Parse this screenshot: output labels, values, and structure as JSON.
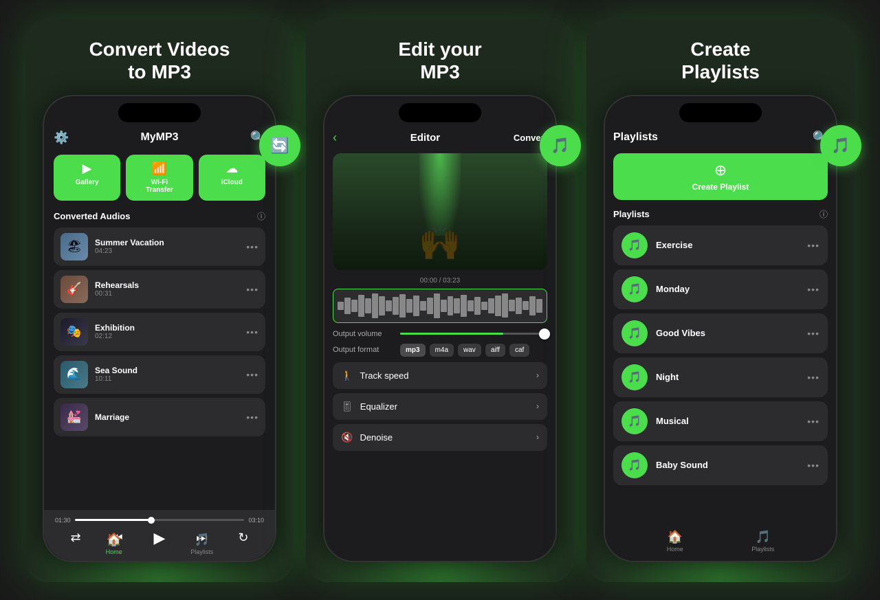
{
  "panels": [
    {
      "title": "Convert Videos\nto MP3",
      "floatingIcon": "🔄",
      "phone": {
        "header": {
          "appName": "MyMP3",
          "settingsIcon": "⚙️",
          "searchIcon": "🔍"
        },
        "sourceBtns": [
          {
            "label": "Gallery",
            "icon": "▶"
          },
          {
            "label": "Wi-Fi\nTransfer",
            "icon": "📶"
          },
          {
            "label": "iCloud",
            "icon": "☁"
          }
        ],
        "sectionTitle": "Converted Audios",
        "tracks": [
          {
            "name": "Summer Vacation",
            "time": "04:23",
            "thumbClass": "thumb-summer",
            "emoji": "🏖"
          },
          {
            "name": "Rehearsals",
            "time": "00:31",
            "thumbClass": "thumb-rehearsal",
            "emoji": "🎸"
          },
          {
            "name": "Exhibition",
            "time": "02:12",
            "thumbClass": "thumb-exhibition",
            "emoji": "🎭"
          },
          {
            "name": "Sea Sound",
            "time": "10:11",
            "thumbClass": "thumb-sea",
            "emoji": "🌊"
          },
          {
            "name": "Marriage",
            "time": "",
            "thumbClass": "thumb-marriage",
            "emoji": "💒"
          }
        ],
        "player": {
          "timeStart": "01:30",
          "timeEnd": "03:10"
        },
        "nav": [
          {
            "label": "Home",
            "icon": "🏠",
            "active": true
          },
          {
            "label": "Playlists",
            "icon": "🎵",
            "active": false
          }
        ]
      }
    },
    {
      "title": "Edit your\nMP3",
      "floatingIcon": "🎵",
      "phone": {
        "header": {
          "backLabel": "‹",
          "title": "Editor",
          "convertLabel": "Convert"
        },
        "timeDisplay": "00:00 / 03:23",
        "outputVolume": "Output volume",
        "outputFormat": "Output format",
        "formats": [
          "mp3",
          "m4a",
          "wav",
          "aiff",
          "caf"
        ],
        "activeFormat": "mp3",
        "options": [
          {
            "icon": "🚶",
            "label": "Track speed"
          },
          {
            "icon": "🎚",
            "label": "Equalizer"
          },
          {
            "icon": "🔇",
            "label": "Denoise"
          }
        ]
      }
    },
    {
      "title": "Create\nPlaylists",
      "floatingIcon": "🎵",
      "phone": {
        "header": {
          "title": "Playlists",
          "searchIcon": "🔍"
        },
        "createBtn": "Create Playlist",
        "sectionTitle": "Playlists",
        "playlists": [
          {
            "name": "Exercise"
          },
          {
            "name": "Monday"
          },
          {
            "name": "Good Vibes"
          },
          {
            "name": "Night"
          },
          {
            "name": "Musical"
          },
          {
            "name": "Baby Sound"
          }
        ],
        "nav": [
          {
            "label": "Home",
            "icon": "🏠",
            "active": false
          },
          {
            "label": "Playlists",
            "icon": "🎵",
            "active": false
          }
        ]
      }
    }
  ]
}
